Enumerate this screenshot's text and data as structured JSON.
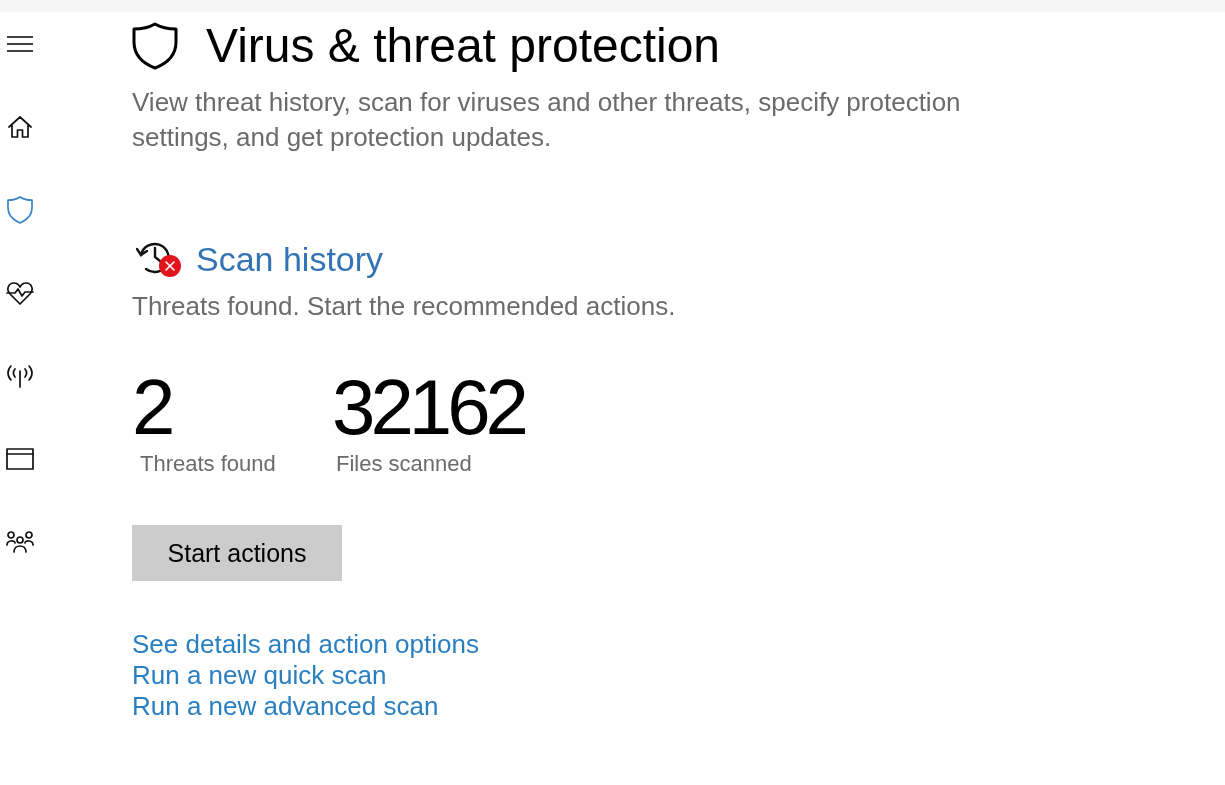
{
  "sidebar": {
    "items": [
      {
        "kind": "home",
        "selected": false
      },
      {
        "kind": "shield",
        "selected": true
      },
      {
        "kind": "health",
        "selected": false
      },
      {
        "kind": "network",
        "selected": false
      },
      {
        "kind": "app",
        "selected": false
      },
      {
        "kind": "family",
        "selected": false
      }
    ]
  },
  "page": {
    "title": "Virus & threat protection",
    "description": "View threat history, scan for viruses and other threats, specify protection settings, and get protection updates."
  },
  "scan_history": {
    "title": "Scan history",
    "status": "Threats found. Start the recommended actions.",
    "stats": [
      {
        "value": "2",
        "label": "Threats found"
      },
      {
        "value": "32162",
        "label": "Files scanned"
      }
    ],
    "button": "Start actions",
    "links": [
      "See details and action options",
      "Run a new quick scan",
      "Run a new advanced scan"
    ]
  }
}
